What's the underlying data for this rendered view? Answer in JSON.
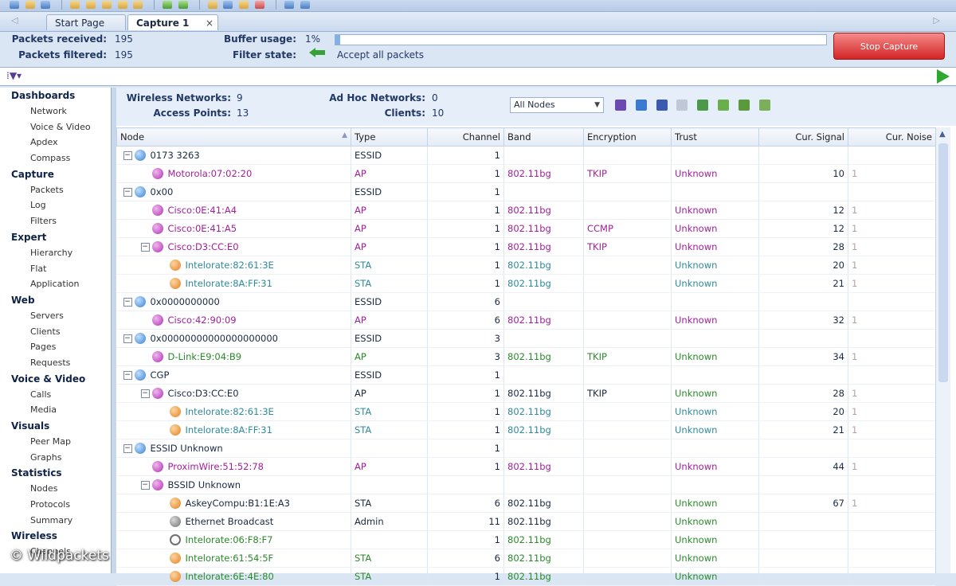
{
  "tabs": {
    "start_page": "Start Page",
    "capture": "Capture 1",
    "close_glyph": "×"
  },
  "stats": {
    "packets_received_label": "Packets received:",
    "packets_received": "195",
    "packets_filtered_label": "Packets filtered:",
    "packets_filtered": "195",
    "buffer_usage_label": "Buffer usage:",
    "buffer_usage": "1%",
    "buffer_fraction": 0.01,
    "filter_state_label": "Filter state:",
    "filter_state": "Accept all packets",
    "stop_capture": "Stop Capture"
  },
  "summary": {
    "wireless_networks_label": "Wireless Networks:",
    "wireless_networks": "9",
    "access_points_label": "Access Points:",
    "access_points": "13",
    "adhoc_networks_label": "Ad Hoc Networks:",
    "adhoc_networks": "0",
    "clients_label": "Clients:",
    "clients": "10",
    "node_filter": "All Nodes"
  },
  "sidebar": [
    {
      "group": "Dashboards",
      "items": [
        "Network",
        "Voice & Video",
        "Apdex",
        "Compass"
      ]
    },
    {
      "group": "Capture",
      "items": [
        "Packets",
        "Log",
        "Filters"
      ]
    },
    {
      "group": "Expert",
      "items": [
        "Hierarchy",
        "Flat",
        "Application"
      ]
    },
    {
      "group": "Web",
      "items": [
        "Servers",
        "Clients",
        "Pages",
        "Requests"
      ]
    },
    {
      "group": "Voice & Video",
      "items": [
        "Calls",
        "Media"
      ]
    },
    {
      "group": "Visuals",
      "items": [
        "Peer Map",
        "Graphs"
      ]
    },
    {
      "group": "Statistics",
      "items": [
        "Nodes",
        "Protocols",
        "Summary"
      ]
    },
    {
      "group": "Wireless",
      "items": [
        "Channels"
      ]
    }
  ],
  "table": {
    "columns": [
      "Node",
      "Type",
      "Channel",
      "Band",
      "Encryption",
      "Trust",
      "Cur. Signal",
      "Cur. Noise"
    ],
    "rows": [
      {
        "level": 0,
        "exp": "-",
        "icon": "essid",
        "node": "0173 3263",
        "type": "ESSID",
        "channel": "1",
        "band": "",
        "enc": "",
        "trust": "",
        "signal": "",
        "noise": "",
        "color": "#1a2a44"
      },
      {
        "level": 1,
        "exp": "",
        "icon": "ap",
        "node": "Motorola:07:02:20",
        "type": "AP",
        "channel": "1",
        "band": "802.11bg",
        "enc": "TKIP",
        "trust": "Unknown",
        "signal": "10",
        "noise": "1",
        "color": "#a0209a"
      },
      {
        "level": 0,
        "exp": "-",
        "icon": "essid",
        "node": "0x00",
        "type": "ESSID",
        "channel": "1",
        "band": "",
        "enc": "",
        "trust": "",
        "signal": "",
        "noise": "",
        "color": "#1a2a44"
      },
      {
        "level": 1,
        "exp": "",
        "icon": "ap",
        "node": "Cisco:0E:41:A4",
        "type": "AP",
        "channel": "1",
        "band": "802.11bg",
        "enc": "",
        "trust": "Unknown",
        "signal": "12",
        "noise": "1",
        "color": "#a0209a"
      },
      {
        "level": 1,
        "exp": "",
        "icon": "ap",
        "node": "Cisco:0E:41:A5",
        "type": "AP",
        "channel": "1",
        "band": "802.11bg",
        "enc": "CCMP",
        "trust": "Unknown",
        "signal": "12",
        "noise": "1",
        "color": "#a0209a"
      },
      {
        "level": 1,
        "exp": "-",
        "icon": "ap",
        "node": "Cisco:D3:CC:E0",
        "type": "AP",
        "channel": "1",
        "band": "802.11bg",
        "enc": "TKIP",
        "trust": "Unknown",
        "signal": "28",
        "noise": "1",
        "color": "#a0209a"
      },
      {
        "level": 2,
        "exp": "",
        "icon": "sta",
        "node": "Intelorate:82:61:3E",
        "type": "STA",
        "channel": "1",
        "band": "802.11bg",
        "enc": "",
        "trust": "Unknown",
        "signal": "20",
        "noise": "1",
        "color": "#2f8a9a"
      },
      {
        "level": 2,
        "exp": "",
        "icon": "sta",
        "node": "Intelorate:8A:FF:31",
        "type": "STA",
        "channel": "1",
        "band": "802.11bg",
        "enc": "",
        "trust": "Unknown",
        "signal": "21",
        "noise": "1",
        "color": "#2f8a9a"
      },
      {
        "level": 0,
        "exp": "-",
        "icon": "essid",
        "node": "0x0000000000",
        "type": "ESSID",
        "channel": "6",
        "band": "",
        "enc": "",
        "trust": "",
        "signal": "",
        "noise": "",
        "color": "#1a2a44"
      },
      {
        "level": 1,
        "exp": "",
        "icon": "ap",
        "node": "Cisco:42:90:09",
        "type": "AP",
        "channel": "6",
        "band": "802.11bg",
        "enc": "",
        "trust": "Unknown",
        "signal": "32",
        "noise": "1",
        "color": "#a0209a"
      },
      {
        "level": 0,
        "exp": "-",
        "icon": "essid",
        "node": "0x00000000000000000000",
        "type": "ESSID",
        "channel": "3",
        "band": "",
        "enc": "",
        "trust": "",
        "signal": "",
        "noise": "",
        "color": "#1a2a44"
      },
      {
        "level": 1,
        "exp": "",
        "icon": "ap",
        "node": "D-Link:E9:04:B9",
        "type": "AP",
        "channel": "3",
        "band": "802.11bg",
        "enc": "TKIP",
        "trust": "Unknown",
        "signal": "34",
        "noise": "1",
        "color": "#2a8a2a"
      },
      {
        "level": 0,
        "exp": "-",
        "icon": "essid",
        "node": "CGP",
        "type": "ESSID",
        "channel": "1",
        "band": "",
        "enc": "",
        "trust": "",
        "signal": "",
        "noise": "",
        "color": "#1a2a44"
      },
      {
        "level": 1,
        "exp": "-",
        "icon": "ap",
        "node": "Cisco:D3:CC:E0",
        "type": "AP",
        "channel": "1",
        "band": "802.11bg",
        "enc": "TKIP",
        "trust": "Unknown",
        "signal": "28",
        "noise": "1",
        "color": "#1a2a44"
      },
      {
        "level": 2,
        "exp": "",
        "icon": "sta",
        "node": "Intelorate:82:61:3E",
        "type": "STA",
        "channel": "1",
        "band": "802.11bg",
        "enc": "",
        "trust": "Unknown",
        "signal": "20",
        "noise": "1",
        "color": "#2f8a9a"
      },
      {
        "level": 2,
        "exp": "",
        "icon": "sta",
        "node": "Intelorate:8A:FF:31",
        "type": "STA",
        "channel": "1",
        "band": "802.11bg",
        "enc": "",
        "trust": "Unknown",
        "signal": "21",
        "noise": "1",
        "color": "#2f8a9a"
      },
      {
        "level": 0,
        "exp": "-",
        "icon": "essid",
        "node": "ESSID Unknown",
        "type": "",
        "channel": "1",
        "band": "",
        "enc": "",
        "trust": "",
        "signal": "",
        "noise": "",
        "color": "#1a2a44"
      },
      {
        "level": 1,
        "exp": "",
        "icon": "ap",
        "node": "ProximWire:51:52:78",
        "type": "AP",
        "channel": "1",
        "band": "802.11bg",
        "enc": "",
        "trust": "Unknown",
        "signal": "44",
        "noise": "1",
        "color": "#a0209a"
      },
      {
        "level": 1,
        "exp": "-",
        "icon": "ap",
        "node": "BSSID Unknown",
        "type": "",
        "channel": "",
        "band": "",
        "enc": "",
        "trust": "",
        "signal": "",
        "noise": "",
        "color": "#1a2a44"
      },
      {
        "level": 2,
        "exp": "",
        "icon": "sta",
        "node": "AskeyCompu:B1:1E:A3",
        "type": "STA",
        "channel": "6",
        "band": "802.11bg",
        "enc": "",
        "trust": "Unknown",
        "signal": "67",
        "noise": "1",
        "color": "#1a2a44"
      },
      {
        "level": 2,
        "exp": "",
        "icon": "eth",
        "node": "Ethernet Broadcast",
        "type": "Admin",
        "channel": "11",
        "band": "802.11bg",
        "enc": "",
        "trust": "Unknown",
        "signal": "",
        "noise": "",
        "color": "#1a2a44"
      },
      {
        "level": 2,
        "exp": "",
        "icon": "unk",
        "node": "Intelorate:06:F8:F7",
        "type": "",
        "channel": "1",
        "band": "802.11bg",
        "enc": "",
        "trust": "Unknown",
        "signal": "",
        "noise": "",
        "color": "#2a8a2a"
      },
      {
        "level": 2,
        "exp": "",
        "icon": "sta",
        "node": "Intelorate:61:54:5F",
        "type": "STA",
        "channel": "6",
        "band": "802.11bg",
        "enc": "",
        "trust": "Unknown",
        "signal": "",
        "noise": "",
        "color": "#2a8a2a"
      },
      {
        "level": 2,
        "exp": "",
        "icon": "sta",
        "node": "Intelorate:6E:4E:80",
        "type": "STA",
        "channel": "1",
        "band": "802.11bg",
        "enc": "",
        "trust": "Unknown",
        "signal": "",
        "noise": "",
        "color": "#2a8a2a"
      }
    ]
  },
  "watermark": "© Wildpackets"
}
